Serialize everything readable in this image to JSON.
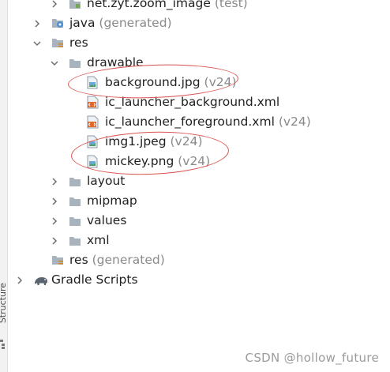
{
  "side_panel": {
    "label": "Structure"
  },
  "tree": {
    "zoom_image_test": {
      "name": "net.zyt.zoom_image",
      "hint": "(test)"
    },
    "java_generated": {
      "name": "java",
      "hint": "(generated)"
    },
    "res": {
      "name": "res"
    },
    "drawable": {
      "name": "drawable"
    },
    "background_jpg": {
      "name": "background.jpg",
      "hint": "(v24)"
    },
    "ic_launcher_background": {
      "name": "ic_launcher_background.xml"
    },
    "ic_launcher_foreground": {
      "name": "ic_launcher_foreground.xml",
      "hint": "(v24)"
    },
    "img1_jpeg": {
      "name": "img1.jpeg",
      "hint": "(v24)"
    },
    "mickey_png": {
      "name": "mickey.png",
      "hint": "(v24)"
    },
    "layout": {
      "name": "layout"
    },
    "mipmap": {
      "name": "mipmap"
    },
    "values": {
      "name": "values"
    },
    "xml": {
      "name": "xml"
    },
    "res_generated": {
      "name": "res",
      "hint": "(generated)"
    },
    "gradle_scripts": {
      "name": "Gradle Scripts"
    }
  },
  "watermark": "CSDN @hollow_future",
  "colors": {
    "annotation_red": "#d9534f",
    "hint_gray": "#8a8a8a",
    "folder_gray": "#a9b3bd"
  },
  "icons": {
    "chevron_right": "chevron-right-icon",
    "chevron_down": "chevron-down-icon",
    "folder": "folder-icon",
    "image_file": "image-file-icon",
    "xml_file": "xml-file-icon",
    "gradle": "gradle-elephant-icon"
  }
}
